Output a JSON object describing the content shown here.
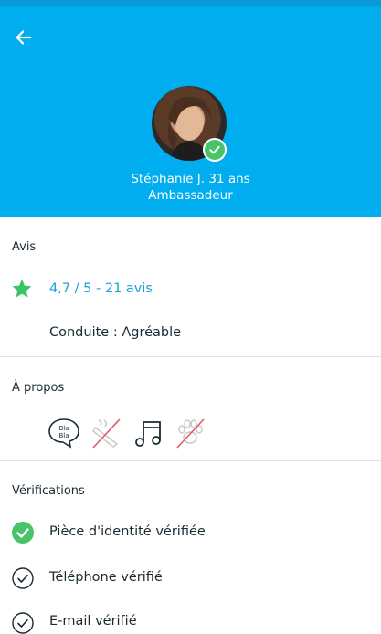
{
  "header": {
    "back_icon": "arrow-left-icon",
    "name_age": "Stéphanie J. 31 ans",
    "level": "Ambassadeur",
    "verified_badge_icon": "check-badge-icon",
    "background_color": "#00adef"
  },
  "reviews": {
    "title": "Avis",
    "rating_text": "4,7 / 5 - 21 avis",
    "rating_icon": "star-icon",
    "rating_color": "#1aa1d8",
    "star_color": "#3ec266",
    "driving_label": "Conduite",
    "driving_separator": " : ",
    "driving_value": "Agréable"
  },
  "about": {
    "title": "À propos",
    "preferences": [
      {
        "icon": "bla-bla-icon",
        "text_line1": "Bla",
        "text_line2": "Bla"
      },
      {
        "icon": "no-smoking-icon"
      },
      {
        "icon": "music-icon"
      },
      {
        "icon": "no-pets-icon"
      }
    ]
  },
  "verifications": {
    "title": "Vérifications",
    "items": [
      {
        "label": "Pièce d'identité vérifiée",
        "icon": "check-filled-icon"
      },
      {
        "label": "Téléphone vérifié",
        "icon": "check-outline-icon"
      },
      {
        "label": "E-mail vérifié",
        "icon": "check-outline-icon"
      }
    ]
  }
}
